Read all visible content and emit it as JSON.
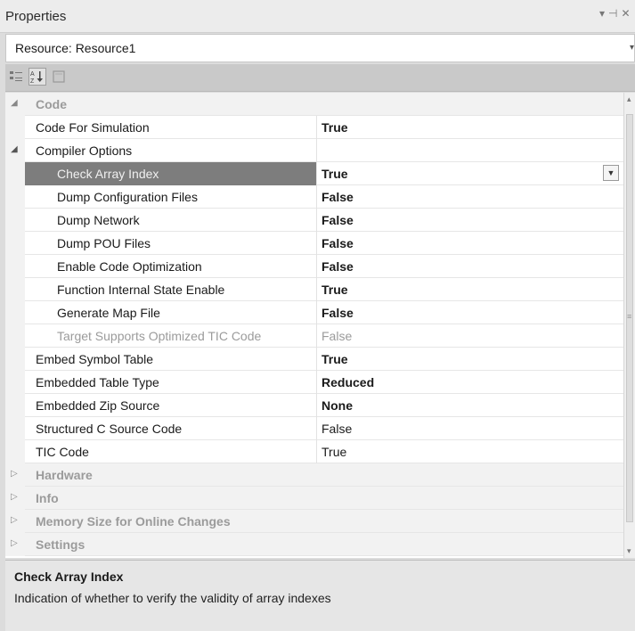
{
  "panel": {
    "title": "Properties",
    "controls": [
      "▾",
      "⊣",
      "✕"
    ]
  },
  "object_selector": {
    "value": "Resource: Resource1"
  },
  "toolbar": {
    "categorized_icon": "categorized-icon",
    "alphabetical_icon": "alphabetical-icon",
    "property_pages_icon": "property-pages-icon"
  },
  "rows": [
    {
      "type": "category",
      "name": "Code",
      "expanded": true
    },
    {
      "type": "prop",
      "indent": 1,
      "name": "Code For Simulation",
      "value": "True",
      "bold": true
    },
    {
      "type": "category-sub",
      "name": "Compiler Options",
      "expanded": true
    },
    {
      "type": "prop",
      "indent": 2,
      "name": "Check Array Index",
      "value": "True",
      "bold": true,
      "selected": true
    },
    {
      "type": "prop",
      "indent": 2,
      "name": "Dump Configuration Files",
      "value": "False",
      "bold": true
    },
    {
      "type": "prop",
      "indent": 2,
      "name": "Dump Network",
      "value": "False",
      "bold": true
    },
    {
      "type": "prop",
      "indent": 2,
      "name": "Dump POU Files",
      "value": "False",
      "bold": true
    },
    {
      "type": "prop",
      "indent": 2,
      "name": "Enable Code Optimization",
      "value": "False",
      "bold": true
    },
    {
      "type": "prop",
      "indent": 2,
      "name": "Function Internal State Enable",
      "value": "True",
      "bold": true
    },
    {
      "type": "prop",
      "indent": 2,
      "name": "Generate Map File",
      "value": "False",
      "bold": true
    },
    {
      "type": "prop",
      "indent": 2,
      "name": "Target Supports Optimized TIC Code",
      "value": "False",
      "bold": false,
      "disabled": true
    },
    {
      "type": "prop",
      "indent": 1,
      "name": "Embed Symbol Table",
      "value": "True",
      "bold": true
    },
    {
      "type": "prop",
      "indent": 1,
      "name": "Embedded Table Type",
      "value": "Reduced",
      "bold": true
    },
    {
      "type": "prop",
      "indent": 1,
      "name": "Embedded Zip Source",
      "value": "None",
      "bold": true
    },
    {
      "type": "prop",
      "indent": 1,
      "name": "Structured C Source Code",
      "value": "False",
      "bold": false
    },
    {
      "type": "prop",
      "indent": 1,
      "name": "TIC Code",
      "value": "True",
      "bold": false
    },
    {
      "type": "category",
      "name": "Hardware",
      "expanded": false
    },
    {
      "type": "category",
      "name": "Info",
      "expanded": false
    },
    {
      "type": "category",
      "name": "Memory Size for Online Changes",
      "expanded": false
    },
    {
      "type": "category",
      "name": "Settings",
      "expanded": false
    }
  ],
  "description": {
    "title": "Check Array Index",
    "text": "Indication of whether to verify the validity of array indexes"
  }
}
